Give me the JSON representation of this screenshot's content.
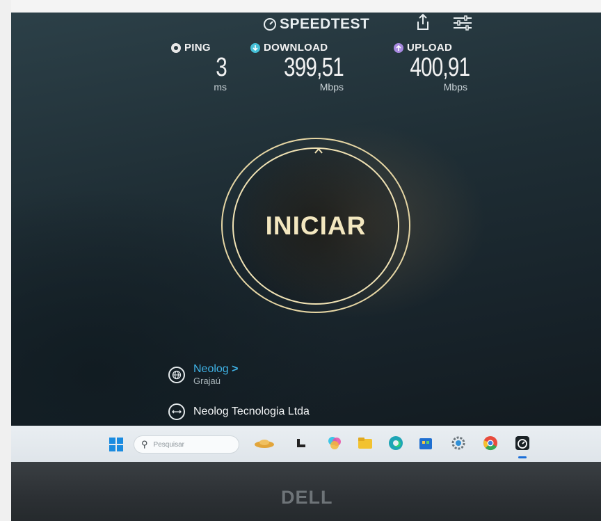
{
  "header": {
    "brand": "SPEEDTEST"
  },
  "metrics": {
    "ping": {
      "label": "PING",
      "value": "3",
      "unit": "ms"
    },
    "download": {
      "label": "DOWNLOAD",
      "value": "399,51",
      "unit": "Mbps"
    },
    "upload": {
      "label": "UPLOAD",
      "value": "400,91",
      "unit": "Mbps"
    }
  },
  "start": {
    "label": "INICIAR"
  },
  "server": {
    "name": "Neolog",
    "chevron": ">",
    "location": "Grajaú"
  },
  "isp": {
    "name": "Neolog Tecnologia Ltda"
  },
  "taskbar": {
    "search_placeholder": "Pesquisar"
  },
  "bezel": {
    "logo": "DELL"
  },
  "colors": {
    "accent_gold": "#f0e2b4",
    "server_link": "#3fb3e6",
    "download_icon": "#46c1d8",
    "upload_icon": "#a88ae0"
  }
}
